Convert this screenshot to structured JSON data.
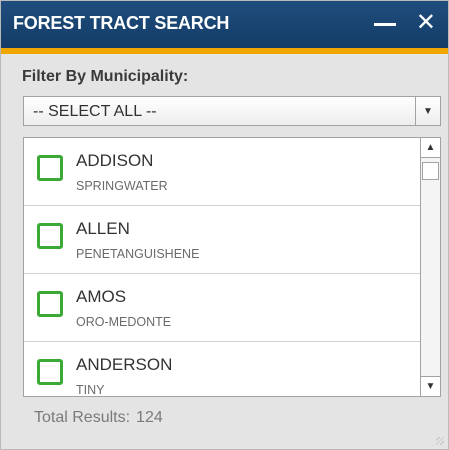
{
  "window": {
    "title": "FOREST TRACT SEARCH",
    "minimize_icon": "minimize-icon",
    "close_icon": "close-icon",
    "close_glyph": "✕"
  },
  "filter": {
    "label": "Filter By Municipality:",
    "selected": "-- SELECT ALL --",
    "arrow_glyph": "▼"
  },
  "results": [
    {
      "name": "ADDISON",
      "municipality": "SPRINGWATER",
      "checked": false
    },
    {
      "name": "ALLEN",
      "municipality": "PENETANGUISHENE",
      "checked": false
    },
    {
      "name": "AMOS",
      "municipality": "ORO-MEDONTE",
      "checked": false
    },
    {
      "name": "ANDERSON",
      "municipality": "TINY",
      "checked": false
    }
  ],
  "scrollbar": {
    "up_glyph": "▲",
    "down_glyph": "▼"
  },
  "footer": {
    "label": "Total Results:",
    "count": "124"
  },
  "colors": {
    "title_bar": "#1a4573",
    "accent": "#f0a600",
    "checkbox": "#3aa935"
  }
}
